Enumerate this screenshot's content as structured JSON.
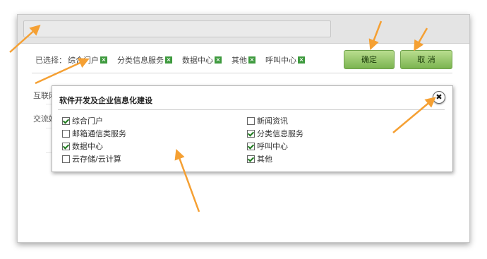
{
  "selected": {
    "label": "已选择：",
    "items": [
      "综合门户",
      "分类信息服务",
      "数据中心",
      "其他",
      "呼叫中心"
    ]
  },
  "buttons": {
    "ok": "确定",
    "cancel": "取 消"
  },
  "background_rows": [
    {
      "label": "互联网"
    },
    {
      "label": "交流媒"
    }
  ],
  "popup": {
    "title": "软件开发及企业信息化建设",
    "close_glyph": "✖",
    "options": [
      {
        "label": "综合门户",
        "checked": true
      },
      {
        "label": "新闻资讯",
        "checked": false
      },
      {
        "label": "邮箱通信类服务",
        "checked": false
      },
      {
        "label": "分类信息服务",
        "checked": true
      },
      {
        "label": "数据中心",
        "checked": true
      },
      {
        "label": "呼叫中心",
        "checked": true
      },
      {
        "label": "云存储/云计算",
        "checked": false
      },
      {
        "label": "其他",
        "checked": true
      }
    ]
  },
  "icons": {
    "remove": "close-x-icon",
    "check": "checkmark-icon",
    "close": "close-circle-icon"
  },
  "colors": {
    "button_green": "#7bb450",
    "chip_green": "#3e9a3e",
    "arrow": "#f5a033"
  }
}
